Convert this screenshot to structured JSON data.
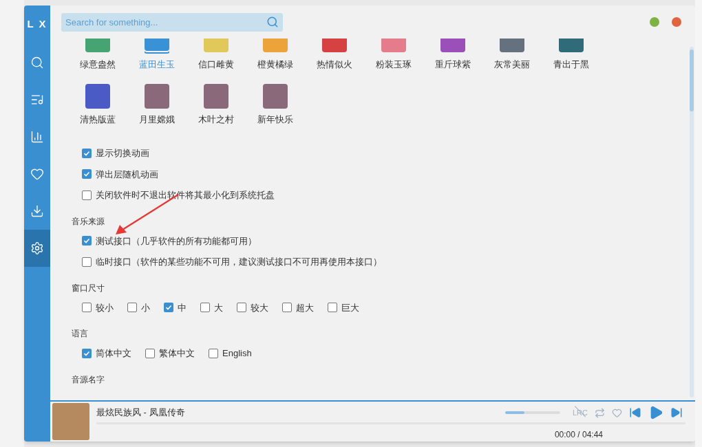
{
  "sidebar": {
    "logo": "L X",
    "items": [
      {
        "kind": "search",
        "selected": false
      },
      {
        "kind": "music-list",
        "selected": false
      },
      {
        "kind": "chart",
        "selected": false
      },
      {
        "kind": "heart",
        "selected": false
      },
      {
        "kind": "download",
        "selected": false
      },
      {
        "kind": "settings",
        "selected": true
      }
    ]
  },
  "search": {
    "placeholder": "Search for something..."
  },
  "window_controls": [
    {
      "color": "#7cb342"
    },
    {
      "color": "#e2643f"
    }
  ],
  "themes": [
    {
      "label": "绿意盎然",
      "kind": "color",
      "color": "#46a472",
      "selected": false
    },
    {
      "label": "蓝田生玉",
      "kind": "color",
      "color": "#3a92d6",
      "selected": true
    },
    {
      "label": "信口雌黄",
      "kind": "color",
      "color": "#e0c95a",
      "selected": false
    },
    {
      "label": "橙黄橘绿",
      "kind": "color",
      "color": "#eca43a",
      "selected": false
    },
    {
      "label": "热情似火",
      "kind": "color",
      "color": "#d64141",
      "selected": false
    },
    {
      "label": "粉装玉琢",
      "kind": "color",
      "color": "#e57c8b",
      "selected": false
    },
    {
      "label": "重斤球紫",
      "kind": "color",
      "color": "#9b4fb8",
      "selected": false
    },
    {
      "label": "灰常美丽",
      "kind": "color",
      "color": "#66717f",
      "selected": false
    },
    {
      "label": "青出于黑",
      "kind": "color",
      "color": "#2f6b78",
      "selected": false
    },
    {
      "label": "清热版蓝",
      "kind": "color",
      "color": "#4a5bc6",
      "selected": false
    },
    {
      "label": "月里嫦娥",
      "kind": "image",
      "selected": false
    },
    {
      "label": "木叶之村",
      "kind": "image",
      "selected": false
    },
    {
      "label": "新年快乐",
      "kind": "image",
      "selected": false
    }
  ],
  "general_options": [
    {
      "label": "显示切换动画",
      "checked": true
    },
    {
      "label": "弹出层随机动画",
      "checked": true
    },
    {
      "label": "关闭软件时不退出软件将其最小化到系统托盘",
      "checked": false
    }
  ],
  "sections": [
    {
      "title": "音乐来源",
      "rows": [
        [
          {
            "label": "测试接口（几乎软件的所有功能都可用）",
            "checked": true
          }
        ],
        [
          {
            "label": "临时接口（软件的某些功能不可用，建议测试接口不可用再使用本接口）",
            "checked": false
          }
        ]
      ]
    },
    {
      "title": "窗口尺寸",
      "rows": [
        [
          {
            "label": "较小",
            "checked": false
          },
          {
            "label": "小",
            "checked": false
          },
          {
            "label": "中",
            "checked": true
          },
          {
            "label": "大",
            "checked": false
          },
          {
            "label": "较大",
            "checked": false
          },
          {
            "label": "超大",
            "checked": false
          },
          {
            "label": "巨大",
            "checked": false
          }
        ]
      ]
    },
    {
      "title": "语言",
      "rows": [
        [
          {
            "label": "简体中文",
            "checked": true
          },
          {
            "label": "繁体中文",
            "checked": false
          },
          {
            "label": "English",
            "checked": false
          }
        ]
      ]
    },
    {
      "title": "音源名字"
    }
  ],
  "player": {
    "title": "最炫民族风 - 凤凰传奇",
    "progress": {
      "level": 0
    },
    "volume": {
      "level": 0.35
    },
    "lyrics_toggle": {
      "label": "LRC",
      "on": false
    },
    "favorite": false,
    "time": "00:00 / 04:44"
  }
}
